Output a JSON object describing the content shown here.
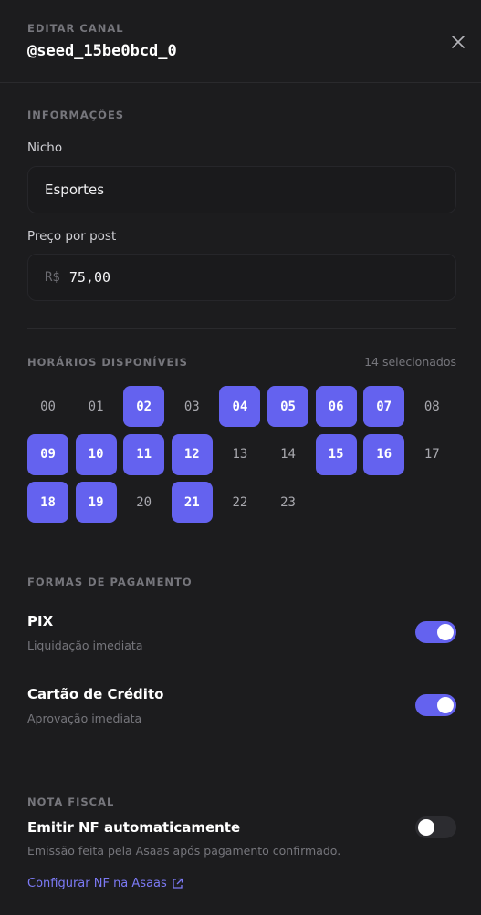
{
  "header": {
    "eyebrow": "EDITAR CANAL",
    "handle": "@seed_15be0bcd_0",
    "close_icon": "close-icon"
  },
  "info": {
    "section_title": "INFORMAÇÕES",
    "niche_label": "Nicho",
    "niche_value": "Esportes",
    "price_label": "Preço por post",
    "price_currency": "R$",
    "price_value": "75,00"
  },
  "schedule": {
    "section_title": "HORÁRIOS DISPONÍVEIS",
    "selected_count": "14 selecionados",
    "slots": [
      {
        "hour": "00",
        "selected": false
      },
      {
        "hour": "01",
        "selected": false
      },
      {
        "hour": "02",
        "selected": true
      },
      {
        "hour": "03",
        "selected": false
      },
      {
        "hour": "04",
        "selected": true
      },
      {
        "hour": "05",
        "selected": true
      },
      {
        "hour": "06",
        "selected": true
      },
      {
        "hour": "07",
        "selected": true
      },
      {
        "hour": "08",
        "selected": false
      },
      {
        "hour": "09",
        "selected": true
      },
      {
        "hour": "10",
        "selected": true
      },
      {
        "hour": "11",
        "selected": true
      },
      {
        "hour": "12",
        "selected": true
      },
      {
        "hour": "13",
        "selected": false
      },
      {
        "hour": "14",
        "selected": false
      },
      {
        "hour": "15",
        "selected": true
      },
      {
        "hour": "16",
        "selected": true
      },
      {
        "hour": "17",
        "selected": false
      },
      {
        "hour": "18",
        "selected": true
      },
      {
        "hour": "19",
        "selected": true
      },
      {
        "hour": "20",
        "selected": false
      },
      {
        "hour": "21",
        "selected": true
      },
      {
        "hour": "22",
        "selected": false
      },
      {
        "hour": "23",
        "selected": false
      }
    ]
  },
  "payments": {
    "section_title": "FORMAS DE PAGAMENTO",
    "methods": [
      {
        "title": "PIX",
        "subtitle": "Liquidação imediata",
        "enabled": true
      },
      {
        "title": "Cartão de Crédito",
        "subtitle": "Aprovação imediata",
        "enabled": true
      }
    ]
  },
  "invoice": {
    "section_title": "NOTA FISCAL",
    "title": "Emitir NF automaticamente",
    "subtitle": "Emissão feita pela Asaas após pagamento confirmado.",
    "enabled": false,
    "link_label": "Configurar NF na Asaas",
    "link_icon": "external-link-icon"
  },
  "colors": {
    "accent": "#6462ef",
    "background": "#1c1c1e",
    "link": "#7c7af5"
  }
}
